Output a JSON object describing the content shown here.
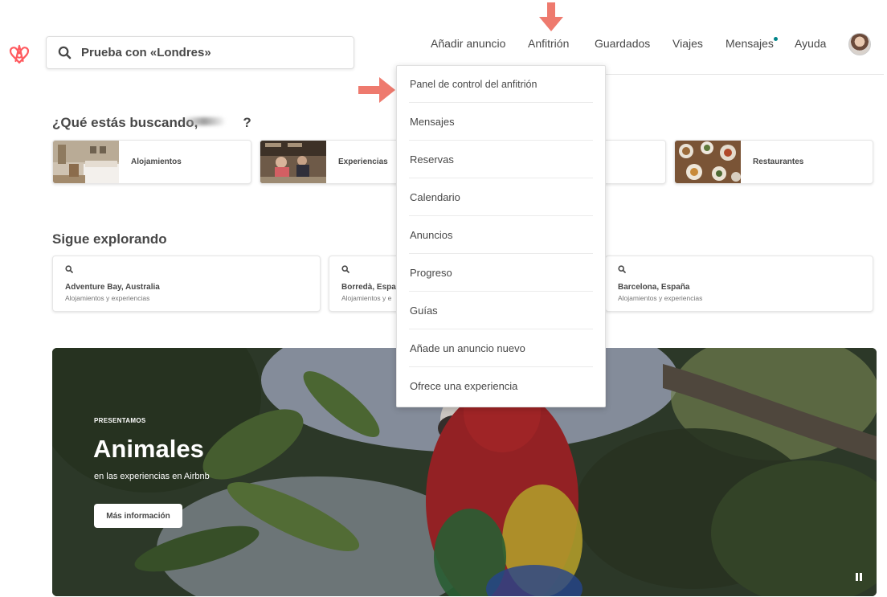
{
  "header": {
    "logo_icon": "airbnb-belo-icon",
    "brand_color": "#FF5A5F",
    "search_placeholder": "Prueba con «Londres»",
    "nav": {
      "add_listing": "Añadir anuncio",
      "host": "Anfitrión",
      "saved": "Guardados",
      "trips": "Viajes",
      "messages": "Mensajes",
      "help": "Ayuda"
    },
    "notification_dot_color": "#008489"
  },
  "host_menu": {
    "items": [
      "Panel de control del anfitrión",
      "Mensajes",
      "Reservas",
      "Calendario",
      "Anuncios",
      "Progreso",
      "Guías",
      "Añade un anuncio nuevo",
      "Ofrece una experiencia"
    ]
  },
  "annotations": {
    "arrow_color": "#EE7A6E"
  },
  "what_looking": {
    "heading_prefix": "¿Qué estás buscando,",
    "heading_suffix": "?",
    "categories": [
      "Alojamientos",
      "Experiencias",
      "Restaurantes"
    ]
  },
  "keep_exploring": {
    "heading": "Sigue explorando",
    "cards": [
      {
        "title": "Adventure Bay, Australia",
        "subtitle": "Alojamientos y experiencias"
      },
      {
        "title": "Borredà, Espa",
        "subtitle": "Alojamientos y e"
      },
      {
        "title": "Barcelona, España",
        "subtitle": "Alojamientos y experiencias"
      }
    ]
  },
  "hero": {
    "kicker": "PRESENTAMOS",
    "title": "Animales",
    "subtitle": "en las experiencias en Airbnb",
    "button_label": "Más información",
    "pause_icon": "pause-icon"
  }
}
